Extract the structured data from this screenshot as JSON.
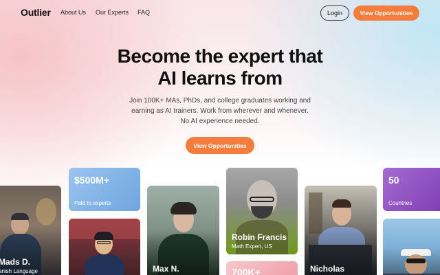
{
  "nav": {
    "logo": "Outlier",
    "links": [
      "About Us",
      "Our Experts",
      "FAQ"
    ],
    "login": "Login",
    "cta": "View Opportunities"
  },
  "hero": {
    "title_line1": "Become the expert that",
    "title_line2": "AI learns from",
    "subtitle_line1": "Join 100K+ MAs, PhDs, and college graduates working and",
    "subtitle_line2": "earning as AI trainers. Work from wherever and whenever.",
    "subtitle_line3": "No AI experience needed.",
    "cta": "View Opportunities"
  },
  "cards": {
    "mads": {
      "name": "Mads D.",
      "sub": "anish Language"
    },
    "stat1": {
      "value": "$500M+",
      "label": "Paid to experts"
    },
    "max": {
      "name": "Max N."
    },
    "robin": {
      "name": "Robin Francis",
      "sub": "Math Expert, US"
    },
    "stat2": {
      "value": "700K+"
    },
    "nicholas": {
      "name": "Nicholas"
    },
    "stat3": {
      "value": "50",
      "label": "Countries"
    }
  },
  "colors": {
    "accent": "#f47c3c",
    "stat1": "#7fb3e8",
    "stat3": "#8e4bc2",
    "robin_gradient_bottom": "#6f9a1c"
  }
}
